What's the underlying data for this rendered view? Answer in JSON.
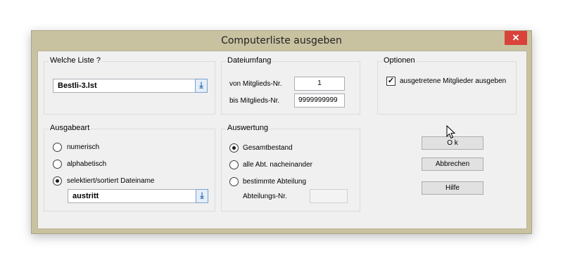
{
  "window": {
    "title": "Computerliste ausgeben",
    "close_glyph": "✕"
  },
  "welche_liste": {
    "title": "Welche Liste ?",
    "value": "Bestli-3.lst",
    "button_icon": "download-arrow-icon",
    "button_glyph": "⤓"
  },
  "dateiumfang": {
    "title": "Dateiumfang",
    "from_label": "von Mitglieds-Nr.",
    "from_value": "1",
    "to_label": "bis  Mitglieds-Nr.",
    "to_value": "9999999999"
  },
  "optionen": {
    "title": "Optionen",
    "checkbox_label": "ausgetretene Mitglieder ausgeben",
    "checked": true,
    "check_glyph": "✓"
  },
  "ausgabeart": {
    "title": "Ausgabeart",
    "options": [
      "numerisch",
      "alphabetisch",
      "selektiert/sortiert Dateiname"
    ],
    "selected_index": 2,
    "file_value": "austritt",
    "button_glyph": "⤓"
  },
  "auswertung": {
    "title": "Auswertung",
    "options": [
      "Gesamtbestand",
      "alle Abt. nacheinander",
      "bestimmte Abteilung"
    ],
    "selected_index": 0,
    "abteilung_label": "Abteilungs-Nr.",
    "abteilung_value": "",
    "button_glyph": "⤓"
  },
  "buttons": {
    "ok": "O k",
    "cancel": "Abbrechen",
    "help": "Hilfe"
  },
  "colors": {
    "frame": "#c8c2a0",
    "close": "#d9423a",
    "accent": "#2f6db3"
  }
}
